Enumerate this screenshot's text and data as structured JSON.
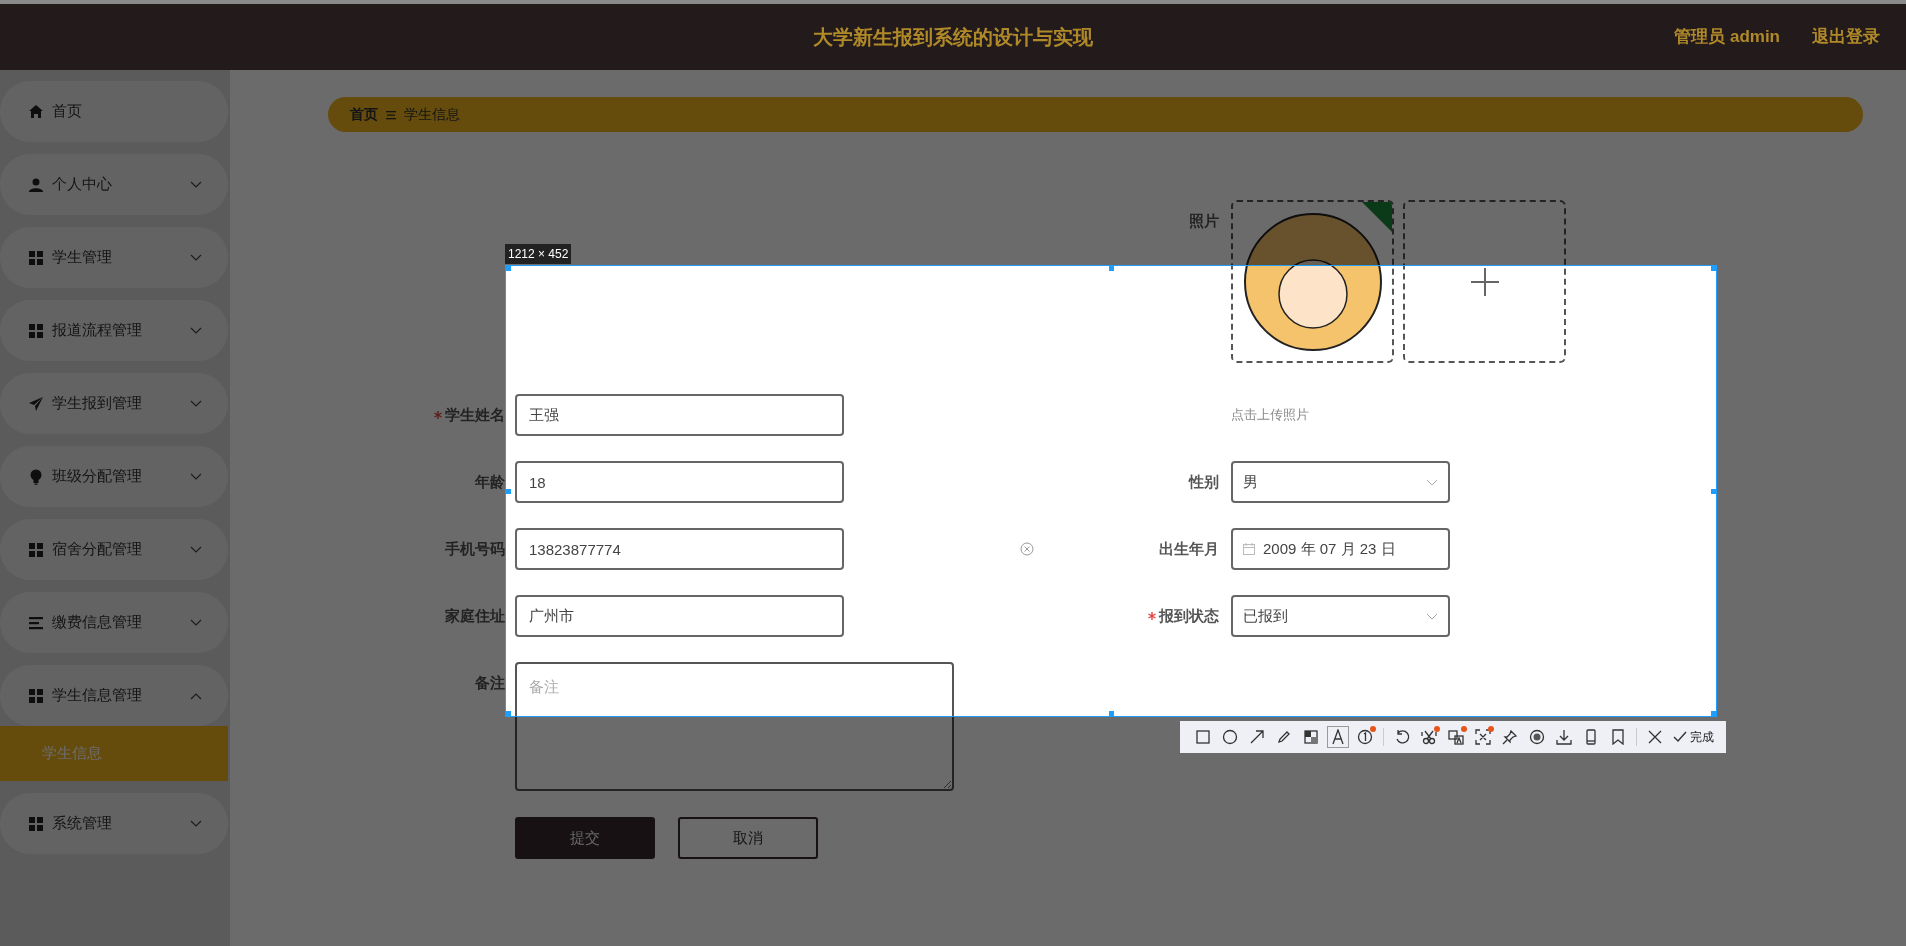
{
  "header": {
    "title": "大学新生报到系统的设计与实现",
    "user": "管理员 admin",
    "logout": "退出登录"
  },
  "sidebar": {
    "items": [
      {
        "kind": "home",
        "label": "首页"
      },
      {
        "kind": "user",
        "label": "个人中心",
        "expanded": false
      },
      {
        "kind": "grid",
        "label": "学生管理",
        "expanded": false
      },
      {
        "kind": "grid",
        "label": "报道流程管理",
        "expanded": false
      },
      {
        "kind": "send",
        "label": "学生报到管理",
        "expanded": false
      },
      {
        "kind": "bulb",
        "label": "班级分配管理",
        "expanded": false
      },
      {
        "kind": "grid",
        "label": "宿舍分配管理",
        "expanded": false
      },
      {
        "kind": "list",
        "label": "缴费信息管理",
        "expanded": false
      },
      {
        "kind": "grid",
        "label": "学生信息管理",
        "expanded": true,
        "children": [
          {
            "label": "学生信息",
            "selected": true
          }
        ]
      },
      {
        "kind": "grid",
        "label": "系统管理",
        "expanded": false
      }
    ]
  },
  "breadcrumb": [
    "首页",
    "学生信息"
  ],
  "form": {
    "photo": {
      "label": "照片",
      "uploaded": true
    },
    "left": [
      {
        "label": "学生姓名",
        "required": true,
        "value": "王强",
        "clearable": false
      },
      {
        "label": "年龄",
        "required": false,
        "value": "18",
        "clearable": false
      },
      {
        "label": "手机号码",
        "required": false,
        "value": "13823877774",
        "clearable": true
      },
      {
        "label": "家庭住址",
        "required": false,
        "value": "广州市",
        "clearable": false
      }
    ],
    "right": [
      {
        "kind": "hint",
        "text": "点击上传照片"
      },
      {
        "kind": "select",
        "label": "性别",
        "required": false,
        "value": "男"
      },
      {
        "kind": "date",
        "label": "出生年月",
        "required": false,
        "value": "2009 年 07 月 23 日"
      },
      {
        "kind": "select",
        "label": "报到状态",
        "required": true,
        "value": "已报到"
      }
    ],
    "remark": {
      "label": "备注",
      "placeholder": "备注"
    },
    "buttons": [
      {
        "label": "提交",
        "kind": "primary"
      },
      {
        "label": "取消",
        "kind": "secondary"
      }
    ]
  },
  "capture": {
    "size": "1212 × 452",
    "done": "完成",
    "tools": [
      {
        "kind": "rectangle",
        "selected": false,
        "dot": false
      },
      {
        "kind": "ellipse",
        "selected": false,
        "dot": false
      },
      {
        "kind": "arrow",
        "selected": false,
        "dot": false
      },
      {
        "kind": "pencil",
        "selected": false,
        "dot": false
      },
      {
        "kind": "mosaic",
        "selected": false,
        "dot": false
      },
      {
        "kind": "text",
        "selected": true,
        "dot": false
      },
      {
        "kind": "number",
        "selected": false,
        "dot": true
      },
      {
        "kind": "sep"
      },
      {
        "kind": "undo",
        "selected": false,
        "dot": false
      },
      {
        "kind": "cut",
        "selected": false,
        "dot": true
      },
      {
        "kind": "translate",
        "selected": false,
        "dot": true
      },
      {
        "kind": "ocr",
        "selected": false,
        "dot": true
      },
      {
        "kind": "pin",
        "selected": false,
        "dot": false
      },
      {
        "kind": "record",
        "selected": false,
        "dot": false
      },
      {
        "kind": "save",
        "selected": false,
        "dot": false
      },
      {
        "kind": "phone",
        "selected": false,
        "dot": false
      },
      {
        "kind": "bookmark",
        "selected": false,
        "dot": false
      },
      {
        "kind": "sep"
      },
      {
        "kind": "cancel",
        "selected": false,
        "dot": false
      }
    ]
  }
}
